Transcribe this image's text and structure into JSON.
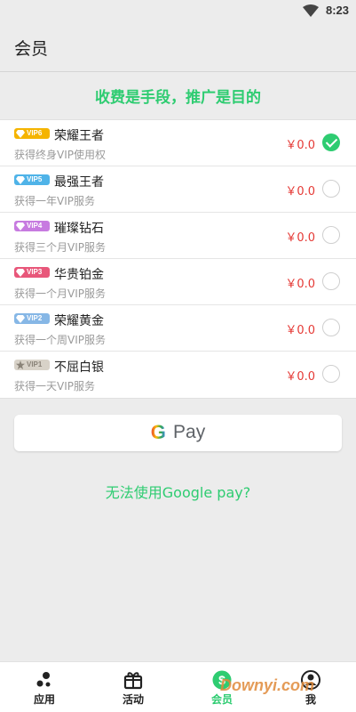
{
  "status_bar": {
    "time": "8:23"
  },
  "header": {
    "title": "会员"
  },
  "slogan": "收费是手段，推广是目的",
  "plans": [
    {
      "badge": "VIP6",
      "badge_color": "#f5b400",
      "name": "荣耀王者",
      "desc": "获得终身VIP使用权",
      "price": "￥0.0",
      "selected": true
    },
    {
      "badge": "VIP5",
      "badge_color": "#4fb3e8",
      "name": "最强王者",
      "desc": "获得一年VIP服务",
      "price": "￥0.0",
      "selected": false
    },
    {
      "badge": "VIP4",
      "badge_color": "#c77be0",
      "name": "璀璨钻石",
      "desc": "获得三个月VIP服务",
      "price": "￥0.0",
      "selected": false
    },
    {
      "badge": "VIP3",
      "badge_color": "#e8577a",
      "name": "华贵铂金",
      "desc": "获得一个月VIP服务",
      "price": "￥0.0",
      "selected": false
    },
    {
      "badge": "VIP2",
      "badge_color": "#86b7e6",
      "name": "荣耀黄金",
      "desc": "获得一个周VIP服务",
      "price": "￥0.0",
      "selected": false
    },
    {
      "badge": "VIP1",
      "badge_color": "#d8d2c8",
      "name": "不屈白银",
      "desc": "获得一天VIP服务",
      "price": "￥0.0",
      "selected": false
    }
  ],
  "payment": {
    "g_letter": "G",
    "pay_text": "Pay"
  },
  "fallback_link": "无法使用Google pay?",
  "bottom_nav": [
    {
      "label": "应用",
      "icon": "apps-dots-icon",
      "active": false
    },
    {
      "label": "活动",
      "icon": "gift-box-icon",
      "active": false
    },
    {
      "label": "会员",
      "icon": "dollar-coin-icon",
      "active": true
    },
    {
      "label": "我",
      "icon": "person-icon",
      "active": false
    }
  ],
  "watermark": "Downyi.com",
  "colors": {
    "accent": "#2ecc71",
    "price": "#e53935"
  }
}
